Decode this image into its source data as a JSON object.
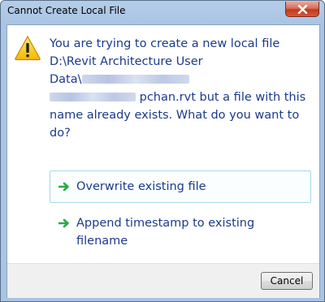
{
  "window": {
    "title": "Cannot Create Local File"
  },
  "message": {
    "line1": "You are trying to create a new local file",
    "line2": "D:\\Revit Architecture User",
    "line3_prefix": "Data\\",
    "line4_suffix": "pchan.rvt but a file with this",
    "line5": "name already exists. What do you want to",
    "line6": "do?"
  },
  "options": [
    {
      "label": "Overwrite existing file"
    },
    {
      "label": "Append timestamp to existing filename"
    }
  ],
  "footer": {
    "cancel_label": "Cancel"
  },
  "colors": {
    "message_text": "#1b3a8c",
    "arrow_green": "#2fa84a",
    "option_hover_border": "#a5d9ea"
  }
}
